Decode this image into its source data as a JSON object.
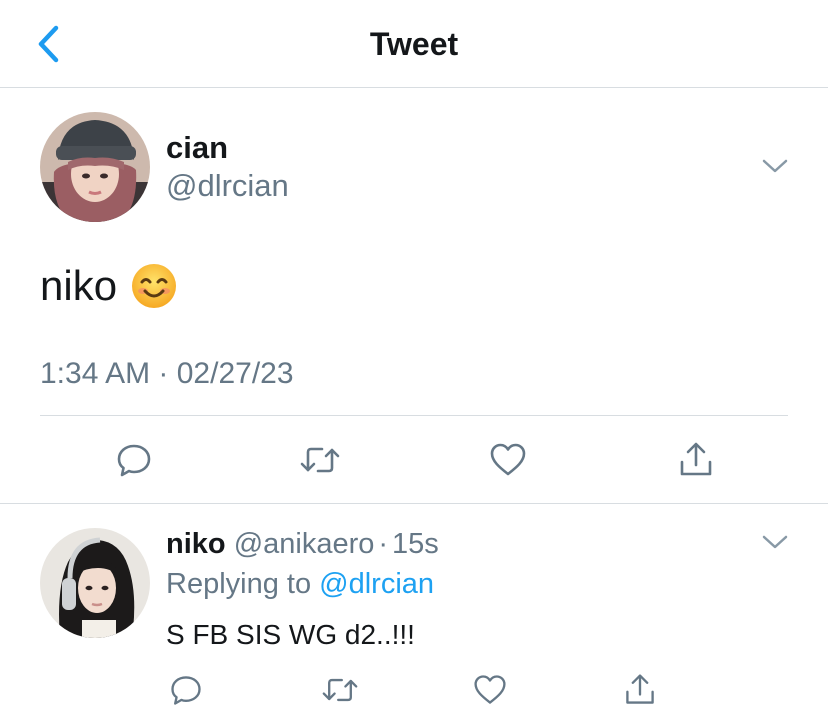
{
  "header": {
    "title": "Tweet",
    "back_icon": "chevron-left-icon"
  },
  "tweet": {
    "author_name": "cian",
    "author_handle": "@dlrcian",
    "text": "niko",
    "emoji": "😊",
    "timestamp_time": "1:34 AM",
    "timestamp_sep": " · ",
    "timestamp_date": "02/27/23",
    "menu_icon": "chevron-down-icon",
    "actions": [
      "reply-icon",
      "retweet-icon",
      "like-icon",
      "share-icon"
    ]
  },
  "reply": {
    "author_name": "niko",
    "author_handle": "@anikaero",
    "dot": "·",
    "time": "15s",
    "replying_prefix": "Replying to ",
    "replying_mention": "@dlrcian",
    "text": "S FB SIS WG d2..!!!",
    "menu_icon": "chevron-down-icon",
    "actions": [
      "reply-icon",
      "retweet-icon",
      "like-icon",
      "share-icon"
    ]
  },
  "colors": {
    "accent": "#1da1f2",
    "muted": "#657786",
    "text": "#14171a",
    "divider": "#d8dde1",
    "back": "#1d9bf0"
  }
}
